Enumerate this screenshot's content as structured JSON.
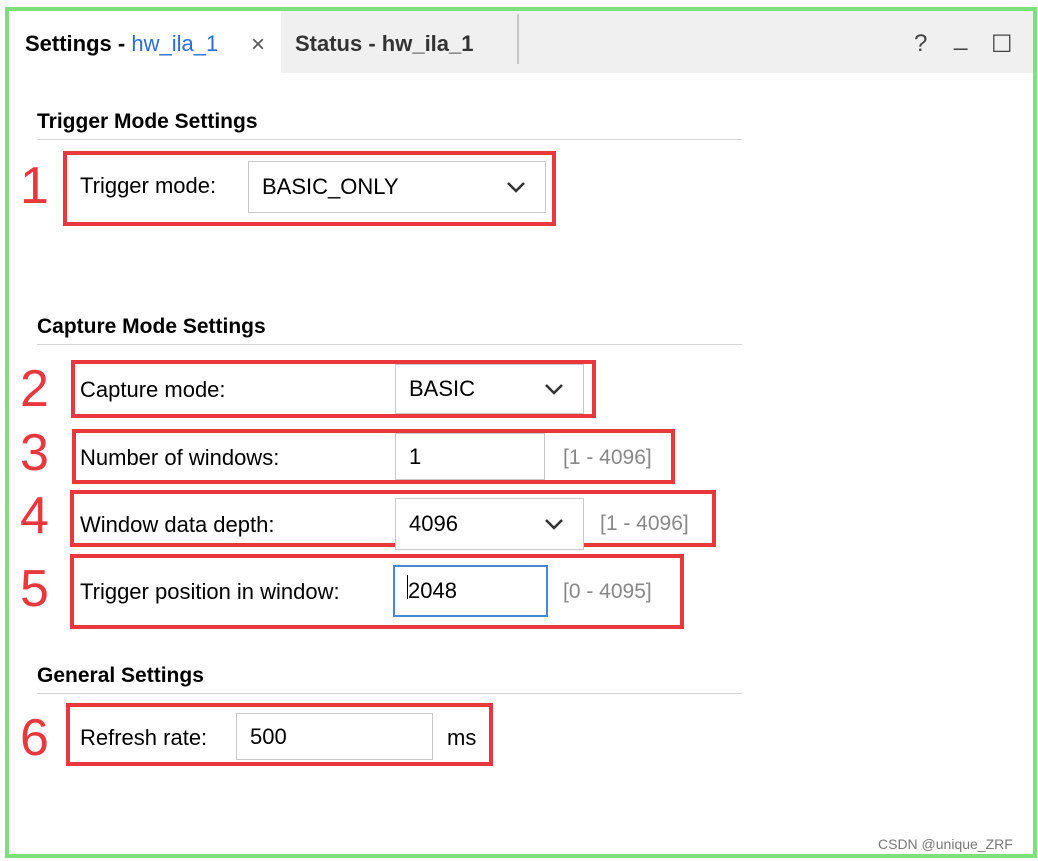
{
  "tabs": {
    "active": {
      "prefix": "Settings - ",
      "name": "hw_ila_1",
      "close": "×"
    },
    "inactive": {
      "label": "Status - hw_ila_1"
    }
  },
  "window_controls": {
    "help": "?",
    "minimize": "_",
    "maximize": "☐"
  },
  "trigger_section": {
    "title": "Trigger Mode Settings",
    "badge": "1",
    "trigger_mode": {
      "label": "Trigger mode:",
      "value": "BASIC_ONLY"
    }
  },
  "capture_section": {
    "title": "Capture Mode Settings",
    "capture_mode": {
      "badge": "2",
      "label": "Capture mode:",
      "value": "BASIC"
    },
    "num_windows": {
      "badge": "3",
      "label": "Number of windows:",
      "value": "1",
      "range": "[1 - 4096]"
    },
    "window_depth": {
      "badge": "4",
      "label": "Window data depth:",
      "value": "4096",
      "range": "[1 - 4096]"
    },
    "trigger_position": {
      "badge": "5",
      "label": "Trigger position in window:",
      "value": "2048",
      "range": "[0 - 4095]"
    }
  },
  "general_section": {
    "title": "General Settings",
    "refresh_rate": {
      "badge": "6",
      "label": "Refresh rate:",
      "value": "500",
      "unit": "ms"
    }
  },
  "watermark": "CSDN @unique_ZRF",
  "colors": {
    "frame": "#7ee07a",
    "highlight": "#e8383d",
    "tab_name": "#2b6fd6",
    "focus": "#4a86d4"
  }
}
